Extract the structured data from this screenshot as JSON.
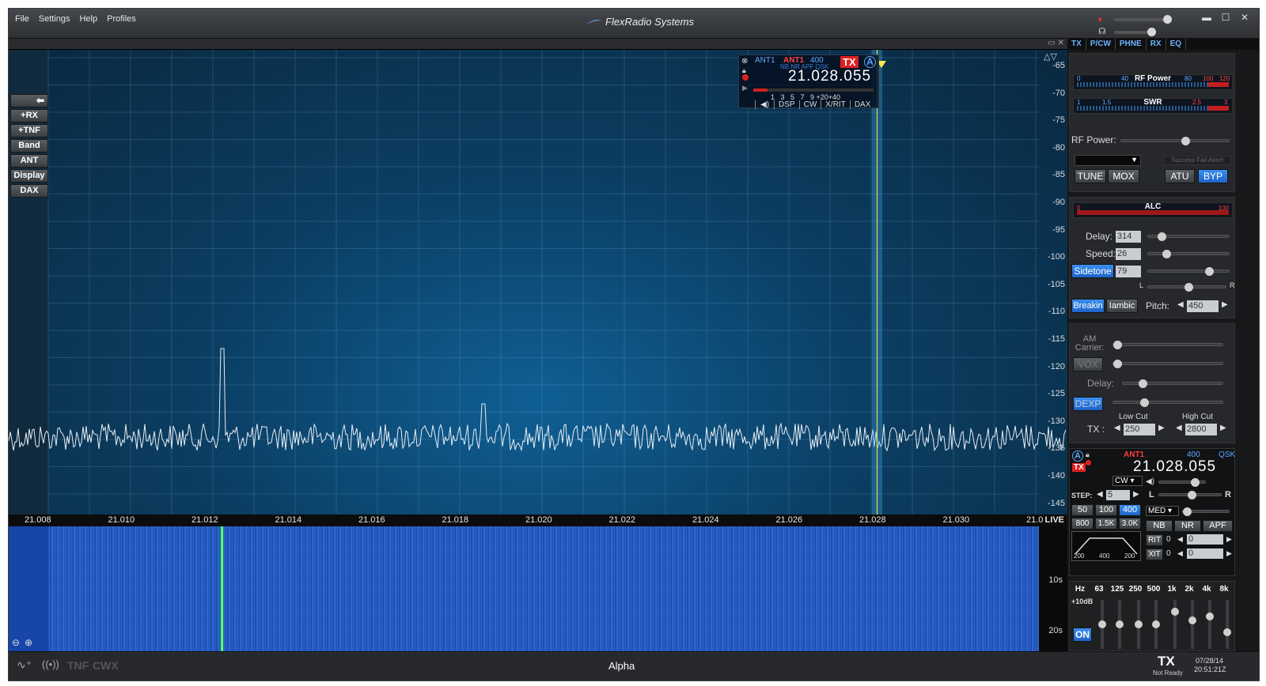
{
  "menu": {
    "file": "File",
    "settings": "Settings",
    "help": "Help",
    "profiles": "Profiles"
  },
  "brand": "FlexRadio Systems",
  "right_tabs": [
    "TX",
    "P/CW",
    "PHNE",
    "RX",
    "EQ"
  ],
  "left_buttons": [
    "+RX",
    "+TNF",
    "Band",
    "ANT",
    "Display",
    "DAX"
  ],
  "freq_axis": [
    "21.008",
    "21.010",
    "21.012",
    "21.014",
    "21.016",
    "21.018",
    "21.020",
    "21.022",
    "21.024",
    "21.026",
    "21.028",
    "21.030",
    "21.0"
  ],
  "live_label": "LIVE",
  "db_axis": [
    "-65",
    "-70",
    "-75",
    "-80",
    "-85",
    "-90",
    "-95",
    "-100",
    "-105",
    "-110",
    "-115",
    "-120",
    "-125",
    "-130",
    "-135",
    "-140",
    "-145"
  ],
  "waterfall_times": [
    "10s",
    "20s"
  ],
  "slice": {
    "ant1": "ANT1",
    "ant1_red": "ANT1",
    "bw": "400",
    "flags": "NB NR APF QSK",
    "tx": "TX",
    "letter": "A",
    "freq": "21.028.055",
    "scale": "1   3   5   7   9 +20+40",
    "tabs": [
      "DSP",
      "CW",
      "X/RIT",
      "DAX"
    ]
  },
  "tx_panel": {
    "rf_power_meter": "RF Power",
    "rf_scale": [
      "0",
      "40",
      "80",
      "100",
      "120"
    ],
    "swr_meter": "SWR",
    "swr_scale": [
      "1",
      "1.5",
      "2.5",
      "3"
    ],
    "rf_power_label": "RF Power:",
    "status_text": "Success Fail Abort",
    "tune": "TUNE",
    "mox": "MOX",
    "atu": "ATU",
    "byp": "BYP",
    "rf_power_level": 0.55
  },
  "cw_panel": {
    "alc_meter": "ALC",
    "alc_scale": [
      "0",
      "100"
    ],
    "delay_label": "Delay:",
    "delay_value": "314",
    "speed_label": "Speed:",
    "speed_value": "26",
    "sidetone": "Sidetone",
    "sidetone_value": "79",
    "pan_l": "L",
    "pan_r": "R",
    "breakin": "Breakin",
    "iambic": "Iambic",
    "pitch_label": "Pitch:",
    "pitch_value": "450"
  },
  "phone_panel": {
    "am_carrier": "AM Carrier:",
    "vox": "VOX",
    "delay": "Delay:",
    "dexp": "DEXP",
    "low_cut": "Low Cut",
    "high_cut": "High Cut",
    "tx_label": "TX :",
    "low_value": "250",
    "high_value": "2800"
  },
  "rx_panel": {
    "letter": "A",
    "tx": "TX",
    "ant": "ANT1",
    "bw": "400",
    "qsk": "QSK",
    "freq": "21.028.055",
    "mode": "CW",
    "step_label": "STEP:",
    "step_value": "5",
    "filters": [
      "50",
      "100",
      "400",
      "800",
      "1.5K",
      "3.0K"
    ],
    "filter_scale": [
      "200",
      "400",
      "200"
    ],
    "lr": [
      "L",
      "R"
    ],
    "agc": "MED",
    "nb": "NB",
    "nr": "NR",
    "apf": "APF",
    "rit": "RIT",
    "rit_val": "0",
    "rit_offset": "0",
    "xit": "XIT",
    "xit_val": "0",
    "xit_offset": "0"
  },
  "eq_panel": {
    "hz": "Hz",
    "bands": [
      "63",
      "125",
      "250",
      "500",
      "1k",
      "2k",
      "4k",
      "8k"
    ],
    "gain_label": "+10dB",
    "on": "ON"
  },
  "status": {
    "tnf": "TNF",
    "cwx": "CWX",
    "station": "Alpha",
    "tx": "TX",
    "not_ready": "Not Ready",
    "date": "07/28/14",
    "time": "20:51:21Z"
  }
}
